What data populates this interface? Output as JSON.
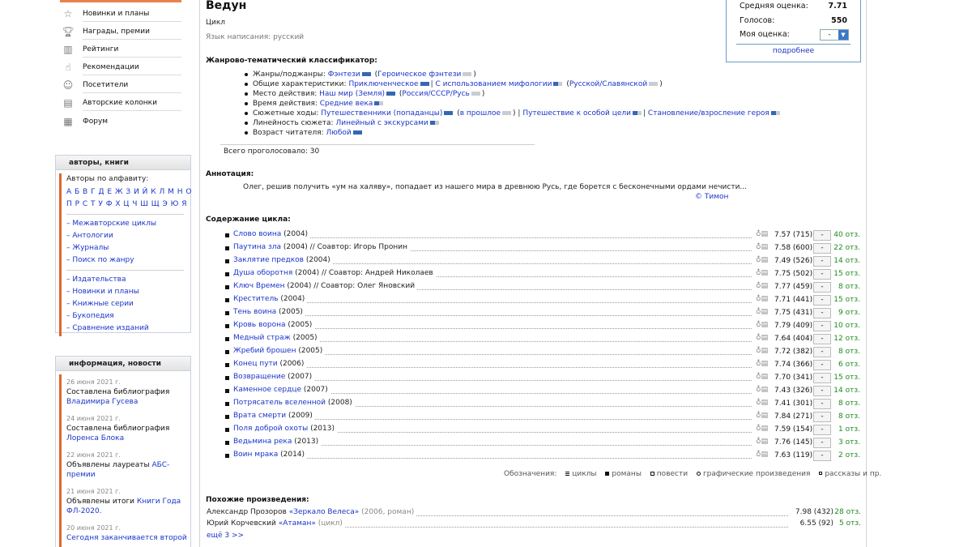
{
  "nav": {
    "items": [
      {
        "label": "Новинки и планы",
        "icon": "star-icon"
      },
      {
        "label": "Награды, премии",
        "icon": "trophy-icon"
      },
      {
        "label": "Рейтинги",
        "icon": "chart-icon"
      },
      {
        "label": "Рекомендации",
        "icon": "thumbs-icon"
      },
      {
        "label": "Посетители",
        "icon": "people-icon"
      },
      {
        "label": "Авторские колонки",
        "icon": "columns-icon"
      },
      {
        "label": "Форум",
        "icon": "forum-icon"
      }
    ]
  },
  "authors_box": {
    "title": "авторы, книги",
    "alpha_title": "Авторы по алфавиту:",
    "alpha_row1": "А Б В Г Д Е Ж З И Й К Л М Н О",
    "alpha_row2": "П Р С Т У Ф Х Ц Ч Ш Щ Э Ю Я",
    "links1": [
      "Межавторские циклы",
      "Антологии",
      "Журналы",
      "Поиск по жанру"
    ],
    "links2": [
      "Издательства",
      "Новинки и планы",
      "Книжные серии",
      "Букопедия",
      "Сравнение изданий"
    ]
  },
  "news_box": {
    "title": "информация, новости",
    "items": [
      {
        "date": "26 июня 2021 г.",
        "text": "Составлена библиография",
        "link": "Владимира Гусева"
      },
      {
        "date": "24 июня 2021 г.",
        "text": "Составлена библиография",
        "link": "Лоренса Блока"
      },
      {
        "date": "22 июня 2021 г.",
        "text": "Объявлены лауреаты",
        "link": "АБС-премии"
      },
      {
        "date": "21 июня 2021 г.",
        "text": "Объявлены итоги",
        "link": "Книги Года ФЛ-2020."
      },
      {
        "date": "20 июня 2021 г.",
        "text": "",
        "link": "Сегодня заканчивается второй"
      }
    ]
  },
  "header": {
    "title": "Ведун",
    "type": "Цикл",
    "lang": "Язык написания: русский"
  },
  "rating": {
    "avg_label": "Средняя оценка:",
    "avg_value": "7.71",
    "votes_label": "Голосов:",
    "votes_value": "550",
    "my_label": "Моя оценка:",
    "my_value": "-",
    "more": "подробнее"
  },
  "classifier": {
    "title": "Жанрово-тематический классификатор:",
    "rows": {
      "genres_label": "Жанры/поджанры:",
      "genres_1": "Фэнтези",
      "genres_2": "Героическое фэнтези",
      "general_label": "Общие характеристики:",
      "general_1": "Приключенческое",
      "general_2": "С использованием мифологии",
      "general_3": "Русской/Славянской",
      "place_label": "Место действия:",
      "place_1": "Наш мир (Земля)",
      "place_2": "Россия/СССР/Русь",
      "time_label": "Время действия:",
      "time_1": "Средние века",
      "plot_label": "Сюжетные ходы:",
      "plot_1": "Путешественники (попаданцы)",
      "plot_2": "в прошлое",
      "plot_3": "Путешествие к особой цели",
      "plot_4": "Становление/взросление героя",
      "linear_label": "Линейность сюжета:",
      "linear_1": "Линейный с экскурсами",
      "age_label": "Возраст читателя:",
      "age_1": "Любой"
    },
    "total": "Всего проголосовало: 30"
  },
  "annotation": {
    "title": "Аннотация:",
    "text": "Олег, решив получить «ум на халяву», попадает из нашего мира в древнюю Русь, где борется с бесконечными ордами нечисти...",
    "author": "© Тимон"
  },
  "contents": {
    "title": "Содержание цикла:",
    "works": [
      {
        "title": "Слово воина",
        "year": " (2004)",
        "co": "",
        "rate": "7.57 (715)",
        "mark": "-",
        "resp": "40 отз."
      },
      {
        "title": "Паутина зла",
        "year": " (2004)",
        "co": " // Соавтор: Игорь Пронин",
        "rate": "7.58 (600)",
        "mark": "-",
        "resp": "22 отз."
      },
      {
        "title": "Заклятие предков",
        "year": " (2004)",
        "co": "",
        "rate": "7.49 (526)",
        "mark": "-",
        "resp": "14 отз."
      },
      {
        "title": "Душа оборотня",
        "year": " (2004)",
        "co": " // Соавтор: Андрей Николаев",
        "rate": "7.75 (502)",
        "mark": "-",
        "resp": "15 отз."
      },
      {
        "title": "Ключ Времен",
        "year": " (2004)",
        "co": " // Соавтор: Олег Яновский",
        "rate": "7.77 (459)",
        "mark": "-",
        "resp": "8 отз."
      },
      {
        "title": "Креститель",
        "year": " (2004)",
        "co": "",
        "rate": "7.71 (441)",
        "mark": "-",
        "resp": "15 отз."
      },
      {
        "title": "Тень воина",
        "year": " (2005)",
        "co": "",
        "rate": "7.75 (431)",
        "mark": "-",
        "resp": "9 отз."
      },
      {
        "title": "Кровь ворона",
        "year": " (2005)",
        "co": "",
        "rate": "7.79 (409)",
        "mark": "-",
        "resp": "10 отз."
      },
      {
        "title": "Медный страж",
        "year": " (2005)",
        "co": "",
        "rate": "7.64 (404)",
        "mark": "-",
        "resp": "12 отз."
      },
      {
        "title": "Жребий брошен",
        "year": " (2005)",
        "co": "",
        "rate": "7.72 (382)",
        "mark": "-",
        "resp": "8 отз."
      },
      {
        "title": "Конец пути",
        "year": " (2006)",
        "co": "",
        "rate": "7.74 (366)",
        "mark": "-",
        "resp": "6 отз."
      },
      {
        "title": "Возвращение",
        "year": " (2007)",
        "co": "",
        "rate": "7.70 (341)",
        "mark": "-",
        "resp": "15 отз."
      },
      {
        "title": "Каменное сердце",
        "year": " (2007)",
        "co": "",
        "rate": "7.43 (326)",
        "mark": "-",
        "resp": "14 отз."
      },
      {
        "title": "Потрясатель вселенной",
        "year": " (2008)",
        "co": "",
        "rate": "7.41 (301)",
        "mark": "-",
        "resp": "8 отз."
      },
      {
        "title": "Врата смерти",
        "year": " (2009)",
        "co": "",
        "rate": "7.84 (271)",
        "mark": "-",
        "resp": "8 отз."
      },
      {
        "title": "Поля доброй охоты",
        "year": " (2013)",
        "co": "",
        "rate": "7.59 (154)",
        "mark": "-",
        "resp": "1 отз."
      },
      {
        "title": "Ведьмина река",
        "year": " (2013)",
        "co": "",
        "rate": "7.76 (145)",
        "mark": "-",
        "resp": "3 отз."
      },
      {
        "title": "Воин мрака",
        "year": " (2014)",
        "co": "",
        "rate": "7.63 (119)",
        "mark": "-",
        "resp": "2 отз."
      }
    ]
  },
  "legend": {
    "label": "Обозначения:",
    "cycles": "циклы",
    "novels": "романы",
    "novellas": "повести",
    "graphic": "графические произведения",
    "stories": "рассказы и пр."
  },
  "similar": {
    "title": "Похожие произведения:",
    "items": [
      {
        "author": "Александр Прозоров",
        "work": "«Зеркало Велеса»",
        "meta": " (2006, роман)",
        "rate": "7.98 (432)",
        "resp": "28 отз."
      },
      {
        "author": "Юрий Корчевский",
        "work": "«Атаман»",
        "meta": " (цикл)",
        "rate": "6.55 (92)",
        "resp": "5 отз."
      }
    ],
    "more": "ещё 3 >>"
  },
  "colors": {
    "accent": "#e0672b",
    "link": "#1a35c8",
    "response": "#1e8a1e",
    "genre_bar": "#3567b6"
  }
}
